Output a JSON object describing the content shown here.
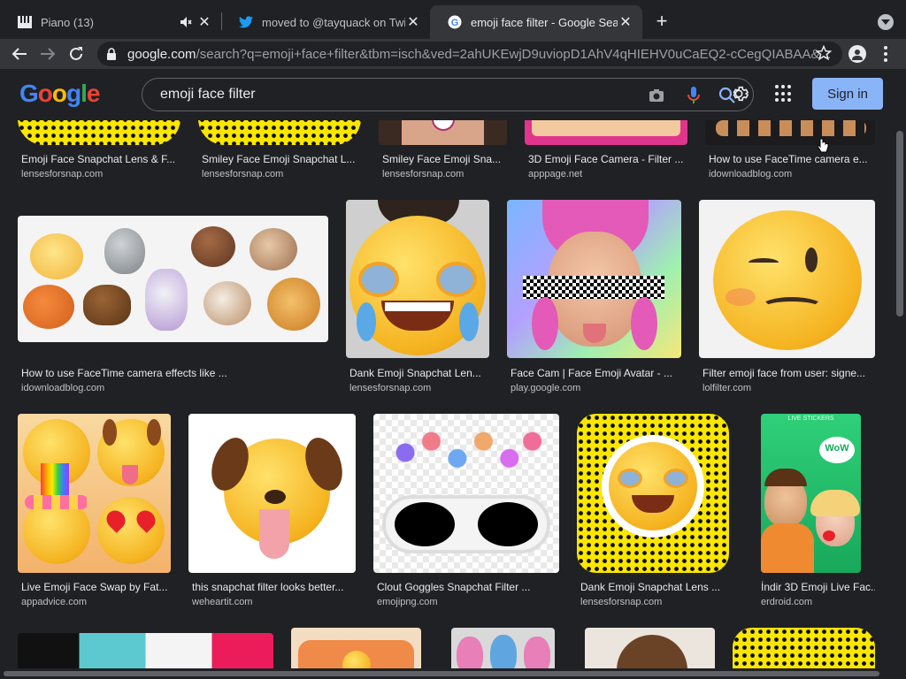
{
  "tabs": [
    {
      "title": "Piano (13)",
      "icon": "piano-icon"
    },
    {
      "title": "moved to @tayquack on Twitter",
      "icon": "twitter-icon"
    },
    {
      "title": "emoji face filter - Google Search",
      "icon": "google-icon"
    }
  ],
  "address_bar": {
    "host": "google.com",
    "path": "/search?q=emoji+face+filter&tbm=isch&ved=2ahUKEwjD9uviopD1AhV4qHIEHV0uCaEQ2-cCegQIABAA&..."
  },
  "logo": {
    "letters": [
      "G",
      "o",
      "o",
      "g",
      "l",
      "e"
    ]
  },
  "search": {
    "query": "emoji face filter"
  },
  "header": {
    "signin_label": "Sign in"
  },
  "colors": {
    "accent": "#8ab4f8",
    "background": "#202124",
    "toolbar": "#35363a",
    "snap_yellow": "#fbe600"
  },
  "results": [
    {
      "title": "Emoji Face Snapchat Lens & F...",
      "source": "lensesforsnap.com"
    },
    {
      "title": "Smiley Face Emoji Snapchat L...",
      "source": "lensesforsnap.com"
    },
    {
      "title": "Smiley Face Emoji Sna...",
      "source": "lensesforsnap.com"
    },
    {
      "title": "3D Emoji Face Camera - Filter ...",
      "source": "apppage.net"
    },
    {
      "title": "How to use FaceTime camera e...",
      "source": "idownloadblog.com"
    },
    {
      "title": "How to use FaceTime camera effects like ...",
      "source": "idownloadblog.com"
    },
    {
      "title": "Dank Emoji Snapchat Len...",
      "source": "lensesforsnap.com"
    },
    {
      "title": "Face Cam | Face Emoji Avatar - ...",
      "source": "play.google.com"
    },
    {
      "title": "Filter emoji face from user: signe...",
      "source": "lolfilter.com"
    },
    {
      "title": "Live Emoji Face Swap by Fat...",
      "source": "appadvice.com"
    },
    {
      "title": "this snapchat filter looks better...",
      "source": "weheartit.com"
    },
    {
      "title": "Clout Goggles Snapchat Filter ...",
      "source": "emojipng.com"
    },
    {
      "title": "Dank Emoji Snapchat Lens ...",
      "source": "lensesforsnap.com"
    },
    {
      "title": "İndir 3D Emoji Live Fac...",
      "source": "erdroid.com"
    }
  ],
  "thumb_text": {
    "wow": "WoW",
    "live_stickers": "LIVE STICKERS"
  }
}
